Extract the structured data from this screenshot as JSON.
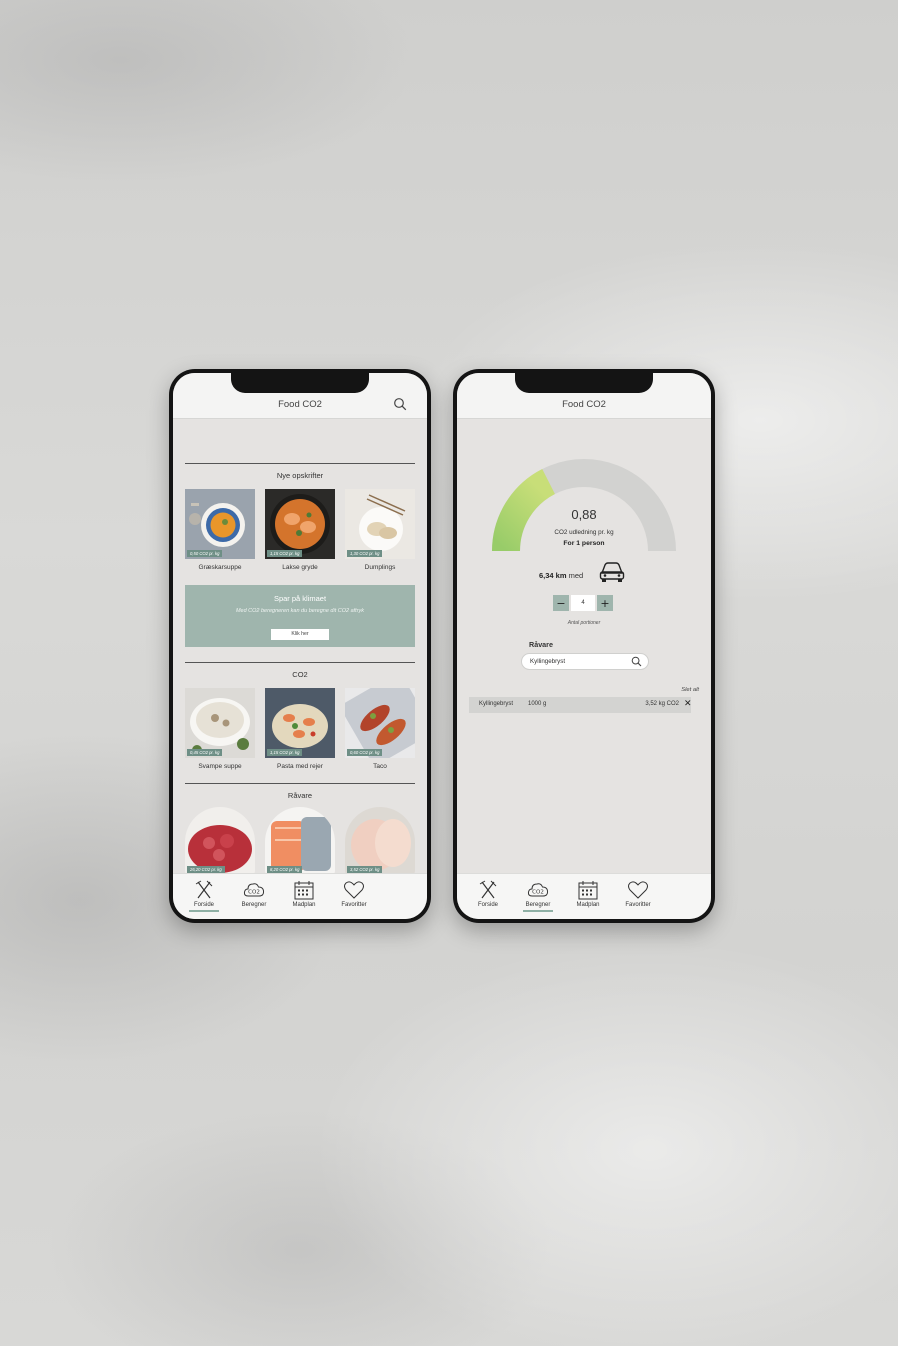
{
  "app_title": "Food CO2",
  "home": {
    "sections": {
      "new_recipes": "Nye opskrifter",
      "co2": "CO2",
      "raw": "Råvare"
    },
    "new_recipes": [
      {
        "label": "Græskarsuppe",
        "badge": "0,50 CO2 pr. kg"
      },
      {
        "label": "Lakse gryde",
        "badge": "1,15 CO2 pr. kg"
      },
      {
        "label": "Dumplings",
        "badge": "1,30 CO2 pr. kg"
      }
    ],
    "banner": {
      "title": "Spar på klimaet",
      "text": "Med CO2 beregneren kan du beregne dit CO2 aftryk",
      "button": "Klik her"
    },
    "co2_recipes": [
      {
        "label": "Svampe suppe",
        "badge": "0,45 CO2 pr. kg"
      },
      {
        "label": "Pasta med rejer",
        "badge": "1,15 CO2 pr. kg"
      },
      {
        "label": "Taco",
        "badge": "0,60 CO2 pr. kg"
      }
    ],
    "raw_items": [
      {
        "badge": "26,20 CO2 pr. kg"
      },
      {
        "badge": "8,20 CO2 pr. kg"
      },
      {
        "badge": "3,52 CO2 pr. kg"
      }
    ]
  },
  "tabs": [
    {
      "label": "Forside",
      "icon": "fork-knife-icon"
    },
    {
      "label": "Beregner",
      "icon": "co2-cloud-icon"
    },
    {
      "label": "Madplan",
      "icon": "calendar-icon"
    },
    {
      "label": "Favoritter",
      "icon": "heart-icon"
    }
  ],
  "calculator": {
    "gauge_value": "0,88",
    "gauge_fraction": 0.35,
    "gauge_caption": "CO2 udledning pr. kg",
    "gauge_person": "For 1 person",
    "distance_value": "6,34 km",
    "distance_suffix": "med",
    "portions": "4",
    "portions_label": "Antal portioner",
    "raw_label": "Råvare",
    "search_value": "Kyllingebryst",
    "delete_all": "Slet alt",
    "ingredient": {
      "name": "Kyllingebryst",
      "amount": "1000 g",
      "co2": "3,52 kg CO2",
      "remove": "✕"
    },
    "minus": "−",
    "plus": "+"
  },
  "colors": {
    "accent": "#9fb5ad",
    "badge": "#6e8f86",
    "gauge_green_start": "#c8de78",
    "gauge_green_end": "#98cc69",
    "gauge_gray": "#d2d2d0"
  }
}
